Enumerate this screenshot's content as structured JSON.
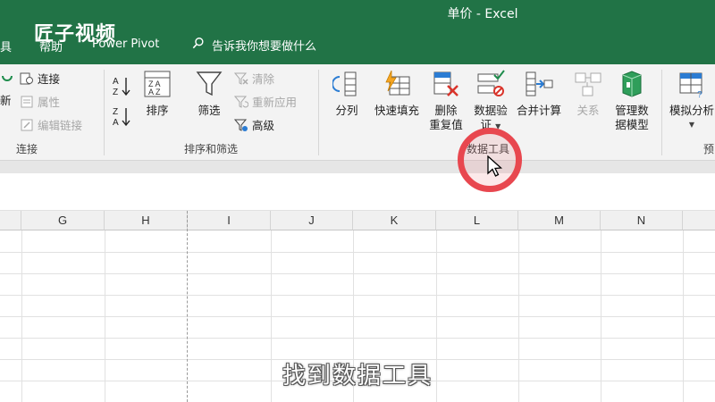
{
  "window": {
    "title": "单价  -  Excel",
    "watermark": "匠子视频"
  },
  "tabs": [
    {
      "label": "具"
    },
    {
      "label": "帮助"
    },
    {
      "label": "Power Pivot"
    }
  ],
  "tell_me": {
    "text": "告诉我你想要做什么"
  },
  "ribbon": {
    "connections": {
      "label": "连接",
      "refresh_label": "新",
      "connections_label": "连接",
      "properties_label": "属性",
      "edit_links_label": "编辑链接"
    },
    "sort_filter": {
      "label": "排序和筛选",
      "sort_label": "排序",
      "filter_label": "筛选",
      "clear_label": "清除",
      "reapply_label": "重新应用",
      "advanced_label": "高级"
    },
    "data_tools": {
      "label": "数据工具",
      "text_to_columns": "分列",
      "flash_fill": "快速填充",
      "remove_duplicates_line1": "删除",
      "remove_duplicates_line2": "重复值",
      "data_validation_line1": "数据验",
      "data_validation_line2": "证",
      "consolidate": "合并计算",
      "relationships": "关系",
      "manage_model_line1": "管理数",
      "manage_model_line2": "据模型"
    },
    "forecast": {
      "label": "预",
      "what_if_label": "模拟分析"
    }
  },
  "columns": [
    "G",
    "H",
    "I",
    "J",
    "K",
    "L",
    "M",
    "N"
  ],
  "subtitle": "找到数据工具",
  "colors": {
    "accent": "#217346",
    "highlight": "#e8474f"
  }
}
